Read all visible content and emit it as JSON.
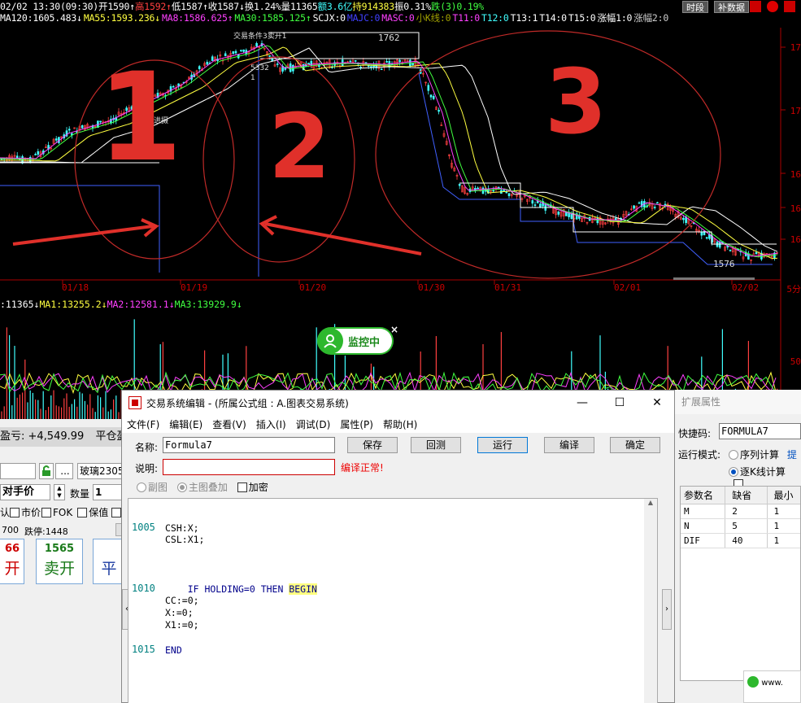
{
  "chart": {
    "top_line": [
      {
        "text": "02/02 13:30(09:30)",
        "color": "#ffffff"
      },
      {
        "text": "开1590↑",
        "color": "#ffffff"
      },
      {
        "text": "高1592↑",
        "color": "#ff4040"
      },
      {
        "text": "低1587↑",
        "color": "#ffffff"
      },
      {
        "text": "收1587↓",
        "color": "#ffffff"
      },
      {
        "text": "换1.24%",
        "color": "#ffffff"
      },
      {
        "text": "量11365",
        "color": "#ffffff"
      },
      {
        "text": "额3.6亿",
        "color": "#40ffff"
      },
      {
        "text": "持914383",
        "color": "#ffff40"
      },
      {
        "text": "振0.31%",
        "color": "#ffffff"
      },
      {
        "text": "跌(3)0.19%",
        "color": "#40ff40"
      }
    ],
    "indicator_line": [
      {
        "text": "MA120:1605.483↓",
        "color": "#ffffff"
      },
      {
        "text": "MA55:1593.236↓",
        "color": "#ffff40"
      },
      {
        "text": "MA8:1586.625↑",
        "color": "#ff40ff"
      },
      {
        "text": "MA30:1585.125↑",
        "color": "#40ff40"
      },
      {
        "text": "SCJX:0",
        "color": "#ffffff"
      },
      {
        "text": "MAJC:0",
        "color": "#4040ff"
      },
      {
        "text": "MASC:0",
        "color": "#ff40ff"
      },
      {
        "text": "小K线:0",
        "color": "#a0a000"
      },
      {
        "text": "T11:0",
        "color": "#ff40ff"
      },
      {
        "text": "T12:0",
        "color": "#40ffff"
      },
      {
        "text": "T13:1",
        "color": "#ffffff"
      },
      {
        "text": "T14:0",
        "color": "#ffffff"
      },
      {
        "text": "T15:0",
        "color": "#ffffff"
      },
      {
        "text": "涨幅1:0",
        "color": "#ffffff"
      },
      {
        "text": "涨幅2:0",
        "color": "#cccccc"
      }
    ],
    "buttons": {
      "timeframe": "时段",
      "fill_data": "补数据"
    },
    "dates": [
      "01/18",
      "01/19",
      "01/20",
      "01/30",
      "01/31",
      "02/01",
      "02/02"
    ],
    "price_labels": {
      "high": "1762",
      "low": "1576"
    },
    "signal_labels": {
      "trade_cond": "交易条件3卖开1",
      "buy_cond": "买进摄",
      "num1": "1",
      "num2": "5332",
      "num3": "1"
    },
    "annotations": {
      "region1": "1",
      "region2": "2",
      "region3": "3"
    },
    "axis_labels": [
      "17",
      "17",
      "16",
      "16",
      "16",
      "5分"
    ]
  },
  "volume": {
    "indicator_line": [
      {
        "text": ":11365↓",
        "color": "#ffffff"
      },
      {
        "text": "MA1:13255.2↓",
        "color": "#ffff40"
      },
      {
        "text": "MA2:12581.1↓",
        "color": "#ff40ff"
      },
      {
        "text": "MA3:13929.9↓",
        "color": "#40ff40"
      }
    ],
    "axis_label": "50",
    "monitor": {
      "label": "监控中",
      "close": "×"
    }
  },
  "left_panel": {
    "pnl_text": "盈亏: +4,549.99",
    "pnl_tab": "平仓盈",
    "contract": "玻璃2305",
    "price_type": "对手价",
    "qty_label": "数量",
    "qty_value": "1",
    "opt_default": "认",
    "opt_market": "市价",
    "opt_fok": "FOK",
    "opt_hedge": "保值",
    "limit_info": "700",
    "limit_down": "跌停:1448",
    "buy_price": "66",
    "buy_action": "开",
    "sell_price": "1565",
    "sell_action": "卖开",
    "close_action": "平"
  },
  "editor": {
    "title": "交易系统编辑 - (所属公式组 : A.图表交易系统)",
    "menus": [
      "文件(F)",
      "编辑(E)",
      "查看(V)",
      "插入(I)",
      "调试(D)",
      "属性(P)",
      "帮助(H)"
    ],
    "name_label": "名称:",
    "name_value": "Formula7",
    "desc_label": "说明:",
    "desc_value": "",
    "status": "编译正常!",
    "buttons": {
      "save": "保存",
      "backtest": "回测",
      "run": "运行",
      "compile": "编译",
      "ok": "确定"
    },
    "opt_sub": "副图",
    "opt_main": "主图叠加",
    "opt_encrypt": "加密",
    "code": {
      "ln1": "1005",
      "l1": "CSH:X;",
      "l2": "CSL:X1;",
      "ln2": "1010",
      "l3_pre": "    IF HOLDING=0 THEN ",
      "l3_kw": "BEGIN",
      "l4": "CC:=0;",
      "l5": "X:=0;",
      "l6": "X1:=0;",
      "ln3": "1015",
      "l7": "END"
    }
  },
  "ext_panel": {
    "title": "扩展属性",
    "shortcut_label": "快捷码:",
    "shortcut_value": "FORMULA7",
    "mode_label": "运行模式:",
    "mode_seq": "序列计算",
    "mode_tick": "逐K线计算",
    "mode_extra": "提",
    "table_headers": [
      "参数名",
      "缺省",
      "最小"
    ],
    "params": [
      {
        "name": "M",
        "default": "2",
        "min": "1"
      },
      {
        "name": "N",
        "default": "5",
        "min": "1"
      },
      {
        "name": "DIF",
        "default": "40",
        "min": "1"
      }
    ],
    "watermark": "www."
  }
}
